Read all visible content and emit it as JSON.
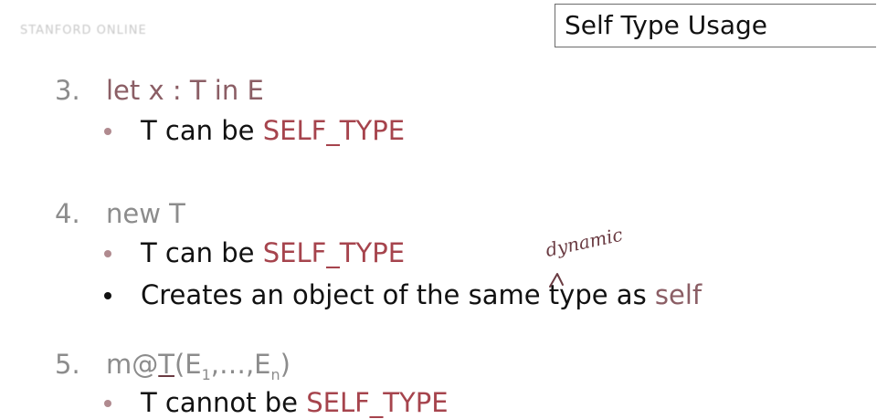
{
  "header": {
    "logo_text": "STANFORD ONLINE",
    "title": "Self Type Usage"
  },
  "items": [
    {
      "number": "3.",
      "heading": "let x : T in E",
      "bullets": [
        {
          "prefix": "T can be ",
          "keyword": "SELF_TYPE"
        }
      ]
    },
    {
      "number": "4.",
      "heading": "new T",
      "bullets": [
        {
          "prefix": "T can be ",
          "keyword": "SELF_TYPE"
        },
        {
          "prefix": "Creates an object of the same type as ",
          "keyword": "self"
        }
      ]
    },
    {
      "number": "5.",
      "heading_prefix": "m@",
      "heading_T": "T",
      "heading_args_open": "(E",
      "heading_sub1": "1",
      "heading_mid": ",…,E",
      "heading_subn": "n",
      "heading_close": ")",
      "bullets": [
        {
          "prefix": "T cannot be ",
          "keyword": "SELF_TYPE"
        }
      ]
    }
  ],
  "annotation": {
    "handwritten": "dynamic",
    "ink_color": "#6a3b42"
  },
  "colors": {
    "heading": "#8b5e65",
    "keyword": "#a6444d",
    "text": "#111111"
  }
}
